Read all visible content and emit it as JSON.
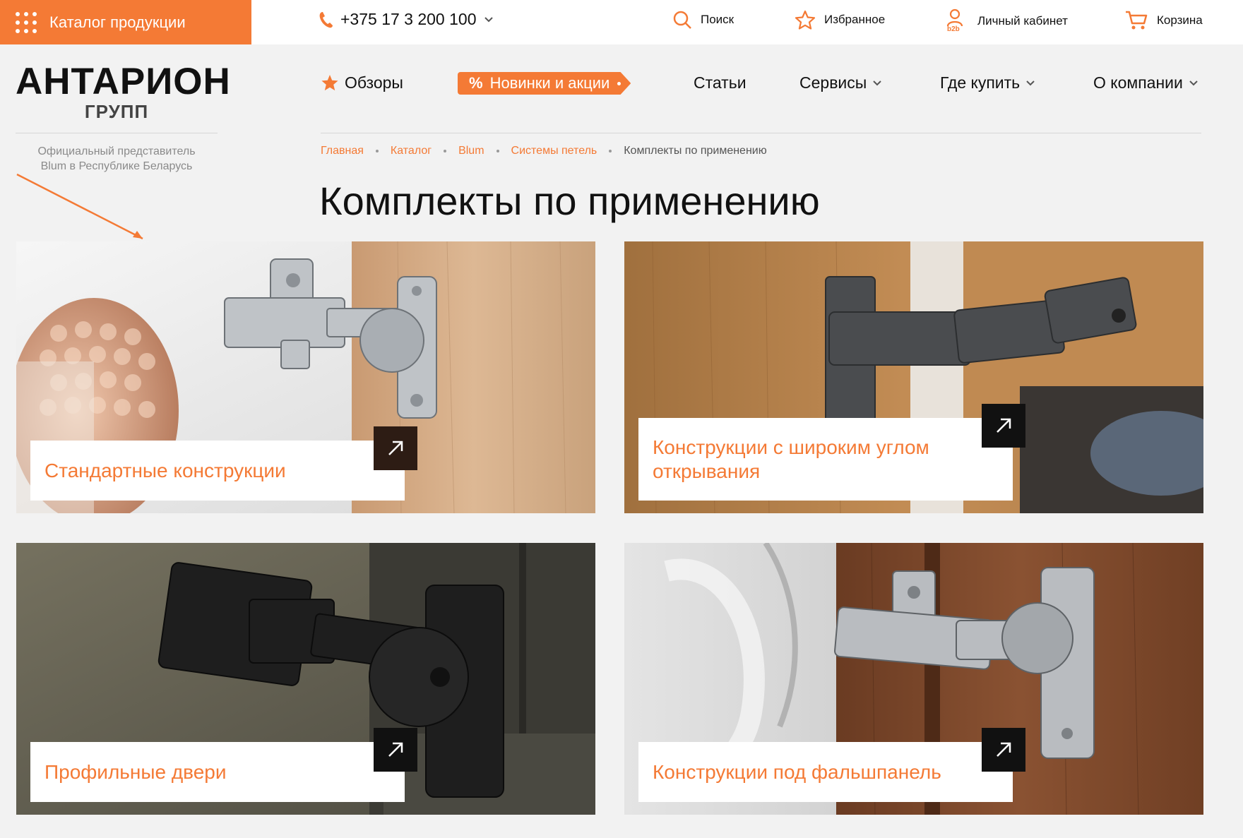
{
  "topbar": {
    "catalog_label": "Каталог продукции",
    "phone": "+375 17 3 200 100",
    "search_label": "Поиск",
    "favorites_label": "Избранное",
    "account_label": "Личный кабинет",
    "account_badge": "b2b",
    "cart_label": "Корзина"
  },
  "logo": {
    "line1": "АНТАРИОН",
    "line2": "ГРУПП",
    "tagline_line1": "Официальный представитель",
    "tagline_line2": "Blum в Республике Беларусь"
  },
  "nav": {
    "reviews": "Обзоры",
    "promo_symbol": "%",
    "promo": "Новинки и акции",
    "articles": "Статьи",
    "services": "Сервисы",
    "where_to_buy": "Где купить",
    "about": "О компании"
  },
  "breadcrumb": [
    "Главная",
    "Каталог",
    "Blum",
    "Системы петель",
    "Комплекты по применению"
  ],
  "page_title": "Комплекты по применению",
  "cards": [
    {
      "title": "Стандартные конструкции",
      "icon": "arrow-up-right-icon"
    },
    {
      "title_line1": "Конструкции с широким углом",
      "title_line2": "открывания",
      "icon": "arrow-up-right-icon"
    },
    {
      "title": "Профильные двери",
      "icon": "arrow-up-right-icon"
    },
    {
      "title": "Конструкции под фальшпанель",
      "icon": "arrow-up-right-icon"
    }
  ],
  "colors": {
    "accent": "#f47a35",
    "background": "#f2f2f2",
    "text": "#111111",
    "muted": "#8a8a8a"
  }
}
